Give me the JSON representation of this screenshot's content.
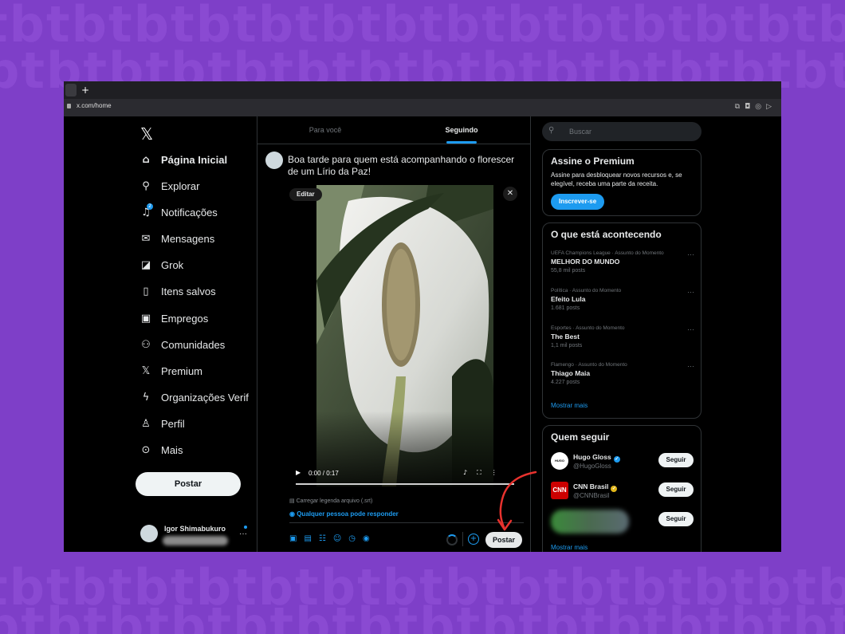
{
  "browser": {
    "url": "x.com/home"
  },
  "nav": {
    "items": [
      {
        "label": "Página Inicial",
        "icon": "home-icon"
      },
      {
        "label": "Explorar",
        "icon": "search-icon"
      },
      {
        "label": "Notificações",
        "icon": "bell-icon"
      },
      {
        "label": "Mensagens",
        "icon": "mail-icon"
      },
      {
        "label": "Grok",
        "icon": "grok-icon"
      },
      {
        "label": "Itens salvos",
        "icon": "bookmark-icon"
      },
      {
        "label": "Empregos",
        "icon": "briefcase-icon"
      },
      {
        "label": "Comunidades",
        "icon": "people-icon"
      },
      {
        "label": "Premium",
        "icon": "x-logo-icon"
      },
      {
        "label": "Organizações Verif",
        "icon": "lightning-icon"
      },
      {
        "label": "Perfil",
        "icon": "person-icon"
      },
      {
        "label": "Mais",
        "icon": "more-circle-icon"
      }
    ],
    "post_label": "Postar",
    "profile_name": "Igor Shimabukuro"
  },
  "feed": {
    "tabs": [
      "Para você",
      "Seguindo"
    ],
    "selected_tab": "Seguindo"
  },
  "composer": {
    "text": "Boa tarde para quem está acompanhando o florescer de um Lírio da Paz!",
    "edit_label": "Editar",
    "video_time": "0:00 / 0:17",
    "caption_label": "Carregar legenda arquivo (.srt)",
    "reply_label": "Qualquer pessoa pode responder",
    "post_label": "Postar"
  },
  "search": {
    "placeholder": "Buscar"
  },
  "premium": {
    "title": "Assine o Premium",
    "text": "Assine para desbloquear novos recursos e, se elegível, receba uma parte da receita.",
    "button": "Inscrever-se"
  },
  "trends": {
    "title": "O que está acontecendo",
    "items": [
      {
        "context": "UEFA Champions League · Assunto do Momento",
        "name": "MELHOR DO MUNDO",
        "count": "55,8 mil posts"
      },
      {
        "context": "Política · Assunto do Momento",
        "name": "Efeito Lula",
        "count": "1.681 posts"
      },
      {
        "context": "Esportes · Assunto do Momento",
        "name": "The Best",
        "count": "1,1 mil posts"
      },
      {
        "context": "Flamengo · Assunto do Momento",
        "name": "Thiago Maia",
        "count": "4.227 posts"
      }
    ],
    "show_more": "Mostrar mais"
  },
  "who_to_follow": {
    "title": "Quem seguir",
    "accounts": [
      {
        "name": "Hugo Gloss",
        "handle": "@HugoGloss",
        "verified_color": "#1d9bf0",
        "avatar_text": "HUGO GLOSS"
      },
      {
        "name": "CNN Brasil",
        "handle": "@CNNBrasil",
        "verified_color": "#e2b719",
        "avatar_text": "CNN"
      }
    ],
    "follow_label": "Seguir",
    "show_more": "Mostrar mais"
  },
  "colors": {
    "accent": "#1d9bf0",
    "background": "#7e3fc8",
    "annotation_arrow": "#e8322e"
  }
}
